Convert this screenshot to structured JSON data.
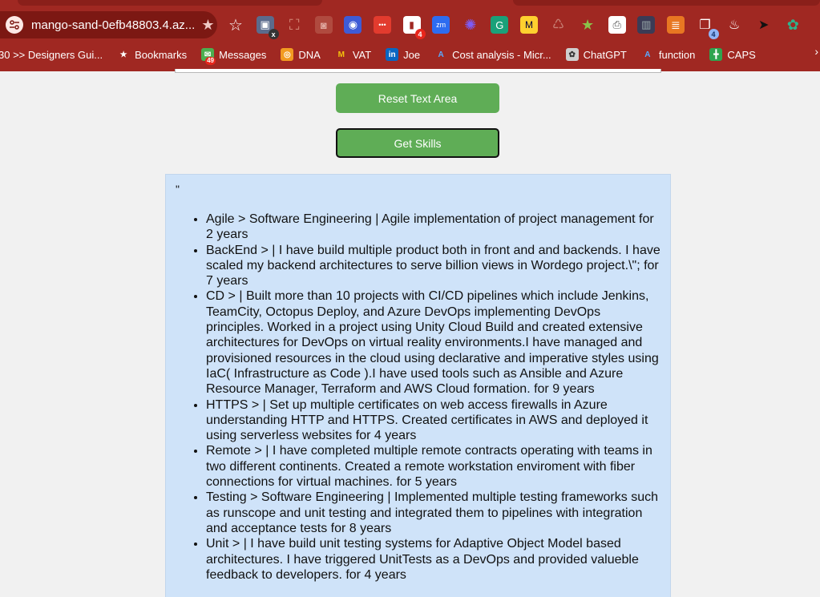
{
  "browser": {
    "url": "mango-sand-0efb48803.4.az...",
    "extensions": [
      {
        "icon": "star-outline-icon",
        "badge": ""
      },
      {
        "icon": "screenshot-tool-icon",
        "badge": "x"
      },
      {
        "icon": "capture-frame-icon",
        "badge": ""
      },
      {
        "icon": "camera-icon",
        "badge": ""
      },
      {
        "icon": "copilot-icon",
        "badge": ""
      },
      {
        "icon": "dots-extension-icon",
        "badge": ""
      },
      {
        "icon": "notification-extension-icon",
        "badge": "4"
      },
      {
        "icon": "zoom-icon",
        "badge": ""
      },
      {
        "icon": "purple-gear-icon",
        "badge": ""
      },
      {
        "icon": "grammarly-icon",
        "badge": ""
      },
      {
        "icon": "miro-icon",
        "badge": ""
      },
      {
        "icon": "recycle-icon",
        "badge": ""
      },
      {
        "icon": "green-star-icon",
        "badge": ""
      },
      {
        "icon": "printer-icon",
        "badge": ""
      },
      {
        "icon": "film-icon",
        "badge": ""
      },
      {
        "icon": "layers-icon",
        "badge": ""
      },
      {
        "icon": "tab-counter-icon",
        "badge": "4"
      },
      {
        "icon": "steam-icon",
        "badge": ""
      },
      {
        "icon": "cursor-icon",
        "badge": ""
      },
      {
        "icon": "openai-icon",
        "badge": ""
      }
    ],
    "bookmarks": [
      {
        "label": "30 >> Designers Gui...",
        "icon": "",
        "badge": ""
      },
      {
        "label": "Bookmarks",
        "icon": "star-icon",
        "badge": ""
      },
      {
        "label": "Messages",
        "icon": "messages-icon",
        "badge": "49"
      },
      {
        "label": "DNA",
        "icon": "dna-icon",
        "badge": ""
      },
      {
        "label": "VAT",
        "icon": "gmail-icon",
        "badge": ""
      },
      {
        "label": "Joe",
        "icon": "linkedin-icon",
        "badge": ""
      },
      {
        "label": "Cost analysis - Micr...",
        "icon": "azure-icon",
        "badge": ""
      },
      {
        "label": "ChatGPT",
        "icon": "chatgpt-icon",
        "badge": ""
      },
      {
        "label": "function",
        "icon": "azure-icon",
        "badge": ""
      },
      {
        "label": "CAPS",
        "icon": "caps-icon",
        "badge": ""
      }
    ],
    "bookmarks_more": "›"
  },
  "buttons": {
    "reset_label": "Reset Text Area",
    "skills_label": "Get Skills"
  },
  "result": {
    "leading_text": "\"",
    "skills": [
      "Agile > Software Engineering | Agile implementation of project management for 2 years",
      "BackEnd > | I have build multiple product both in front and and backends. I have scaled my backend architectures to serve billion views in Wordego project.\\\"; for 7 years",
      "CD > | Built more than 10 projects with CI/CD pipelines which include Jenkins, TeamCity, Octopus Deploy, and Azure DevOps implementing DevOps principles. Worked in a project using Unity Cloud Build and created extensive architectures for DevOps on virtual reality environments.I have managed and provisioned resources in the cloud using declarative and imperative styles using IaC( Infrastructure as Code ).I have used tools such as Ansible and Azure Resource Manager, Terraform and AWS Cloud formation. for 9 years",
      "HTTPS > | Set up multiple certificates on web access firewalls in Azure understanding HTTP and HTTPS. Created certificates in AWS and deployed it using serverless websites for 4 years",
      "Remote > | I have completed multiple remote contracts operating with teams in two different continents. Created a remote workstation enviroment with fiber connections for virtual machines. for 5 years",
      "Testing > Software Engineering | Implemented multiple testing frameworks such as runscope and unit testing and integrated them to pipelines with integration and acceptance tests for 8 years",
      "Unit > | I have build unit testing systems for Adaptive Object Model based architectures. I have triggered UnitTests as a DevOps and provided valueble feedback to developers. for 4 years"
    ]
  },
  "colors": {
    "chrome_bg": "#a02822",
    "button_green": "#5fad56",
    "result_bg": "#cfe3f9"
  }
}
